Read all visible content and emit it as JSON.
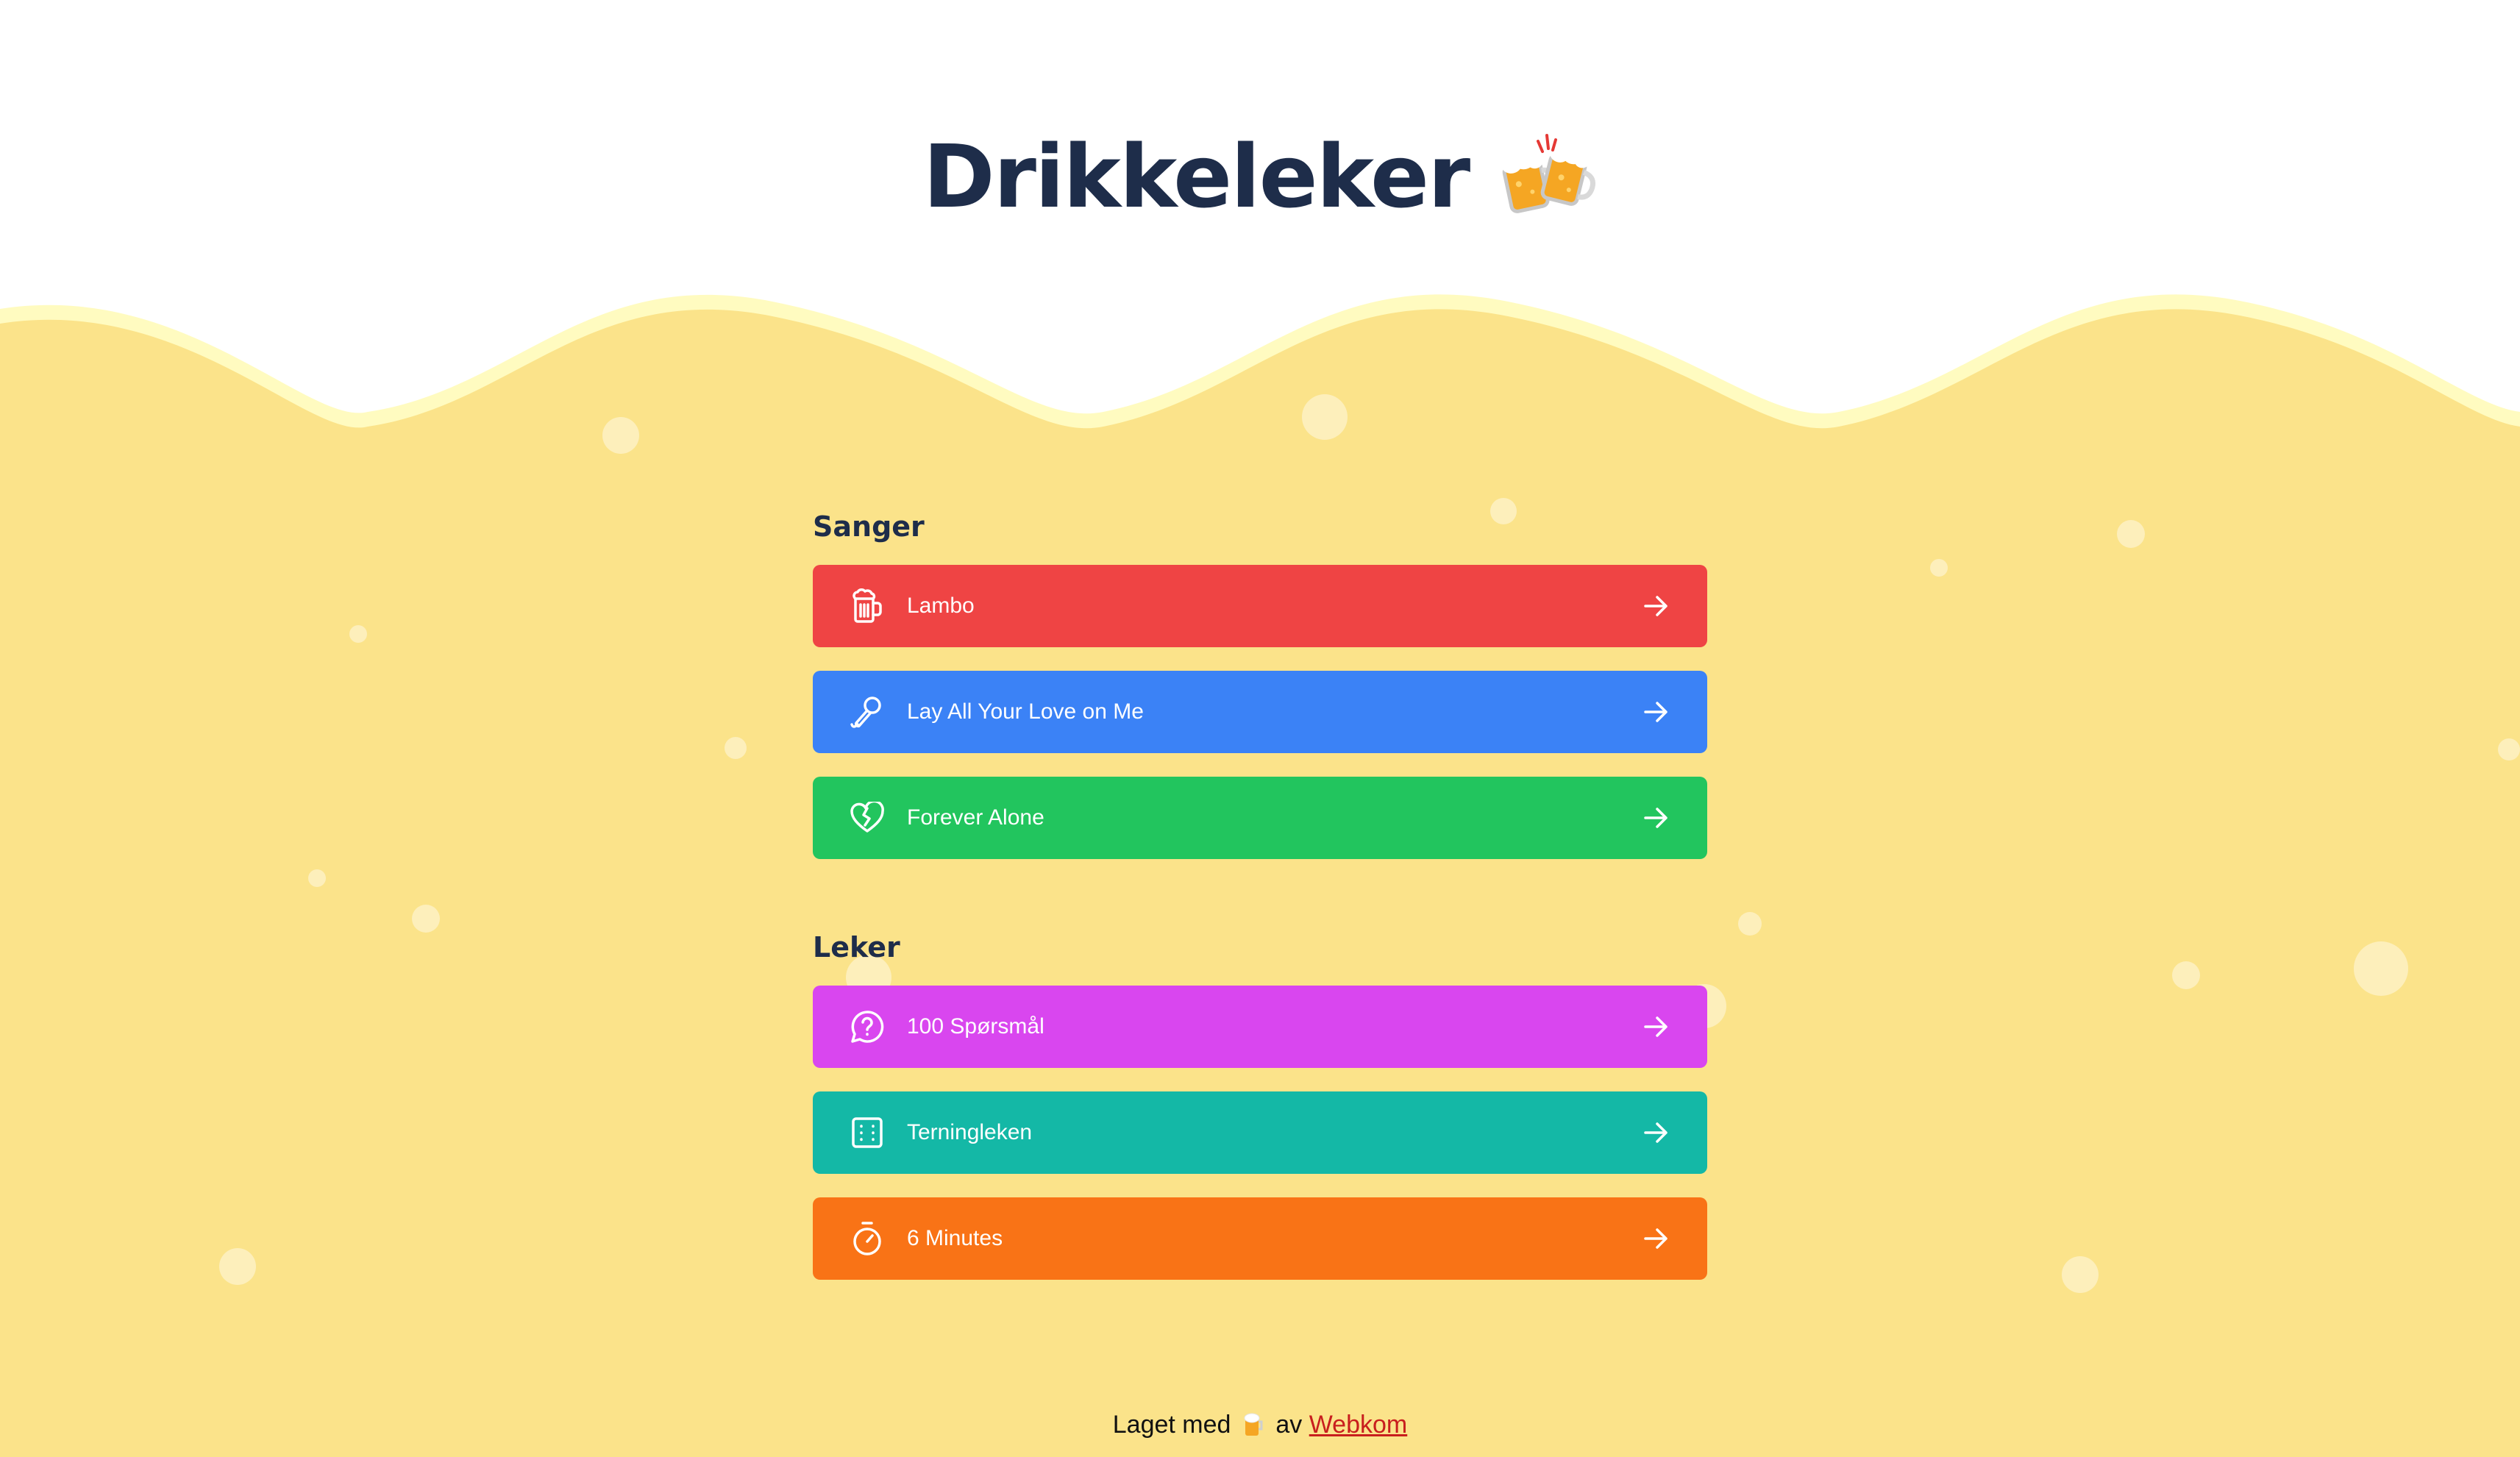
{
  "header": {
    "title": "Drikkeleker",
    "emoji": "clinking-beer-mugs"
  },
  "colors": {
    "title": "#1e2d4a",
    "beer": "#fbe38a",
    "foam": "#fffbc0",
    "bubble": "#fdf1c3"
  },
  "sections": [
    {
      "title": "Sanger",
      "items": [
        {
          "label": "Lambo",
          "icon": "beer-mug-icon",
          "color": "#ef4444"
        },
        {
          "label": "Lay All Your Love on Me",
          "icon": "microphone-icon",
          "color": "#3b82f6"
        },
        {
          "label": "Forever Alone",
          "icon": "broken-heart-icon",
          "color": "#22c55e"
        }
      ]
    },
    {
      "title": "Leker",
      "items": [
        {
          "label": "100 Spørsmål",
          "icon": "question-bubble-icon",
          "color": "#d946ef"
        },
        {
          "label": "Terningleken",
          "icon": "dice-icon",
          "color": "#14b8a6"
        },
        {
          "label": "6 Minutes",
          "icon": "stopwatch-icon",
          "color": "#f97316"
        }
      ]
    }
  ],
  "footer": {
    "prefix": "Laget med",
    "middle": "av",
    "link_label": "Webkom"
  }
}
